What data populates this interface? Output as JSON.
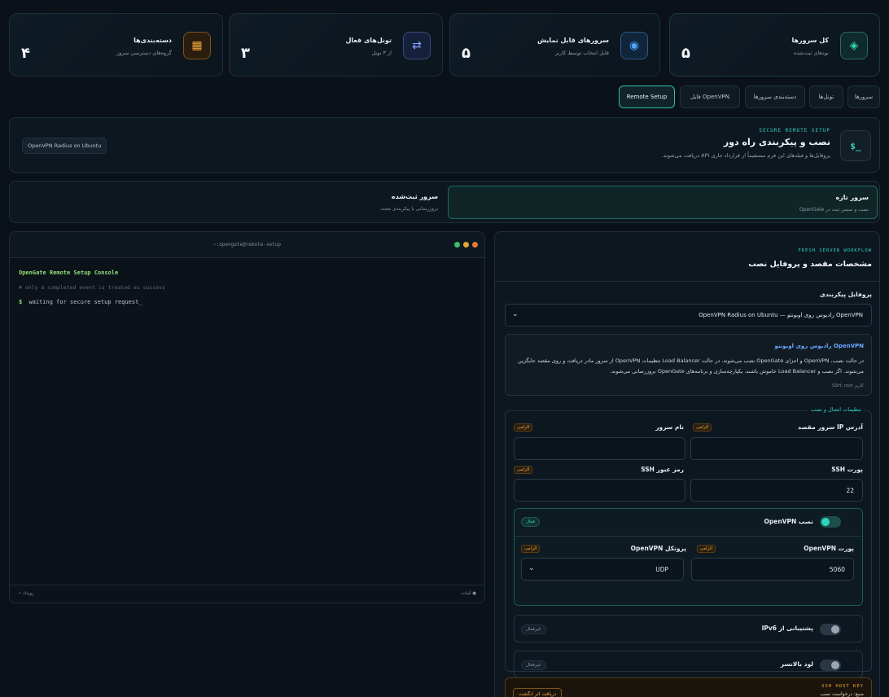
{
  "stats": [
    {
      "label": "کل سرورها",
      "sub": "نودهای ثبت‌شده",
      "value": "۵",
      "icon": "diamond-icon"
    },
    {
      "label": "سرورهای قابل نمایش",
      "sub": "قابل انتخاب توسط کاربر",
      "value": "۵",
      "icon": "target-icon"
    },
    {
      "label": "تونل‌های فعال",
      "sub": "از ۳ تونل",
      "value": "۳",
      "icon": "swap-arrows-icon"
    },
    {
      "label": "دسته‌بندی‌ها",
      "sub": "گروه‌های دسترسی سرور",
      "value": "۴",
      "icon": "grid-icon"
    }
  ],
  "tabs": [
    "سرورها",
    "تونل‌ها",
    "دسته‌بندی سرورها",
    "فایل OpenVPN",
    "Remote Setup"
  ],
  "header": {
    "kicker": "SECURE REMOTE SETUP",
    "title": "نصب و پیکربندی راه دور",
    "desc": "پروفایل‌ها و فیلدهای این فرم مستقیماً از قرارداد جاری API دریافت می‌شوند.",
    "badge": "OpenVPN Radius on Ubuntu",
    "icon_text": "$_"
  },
  "modes": [
    {
      "title": "سرور تازه",
      "sub": "نصب و سپس ثبت در OpenGate"
    },
    {
      "title": "سرور ثبت‌شده",
      "sub": "بروزرسانی یا پیکربندی مجدد"
    }
  ],
  "terminal": {
    "title": "~:opengate@remote-setup",
    "heading": "OpenGate Remote Setup Console",
    "comment": "# only a completed event is treated as success",
    "prompt": "$",
    "line": "waiting for secure setup request_",
    "footer_left": "• رویداد",
    "footer_right": "آماده"
  },
  "form": {
    "kicker": "FRESH SERVER WORKFLOW",
    "title": "مشخصات مقصد و پروفایل نصب",
    "profile_label": "پروفایل پیکربندی",
    "profile_value": "OpenVPN رادیوس روی اوبونتو — OpenVPN Radius on Ubuntu",
    "info_title": "OpenVPN رادیوس روی اوبونتو",
    "info_text": "در حالت نصب، OpenVPN و اجزای OpenGate نصب می‌شوند. در حالت Load Balancer تنظیمات OpenVPN از سرور مادر دریافت و روی مقصد جایگزین می‌شوند. اگر نصب و Load Balancer خاموش باشند، یکپارچه‌سازی و برنامه‌های OpenGate بروزرسانی می‌شوند.",
    "info_user": "کاربر SSH: root",
    "section_title": "تنظیمات اتصال و نصب",
    "required": "الزامی",
    "ip_label": "آدرس IP سرور مقصد",
    "name_label": "نام سرور",
    "ssh_port_label": "پورت SSH",
    "ssh_port_value": "22",
    "ssh_pass_label": "رمز عبور SSH",
    "install_ovpn_label": "نصب OpenVPN",
    "install_ovpn_status": "فعال",
    "ovpn_port_label": "پورت OpenVPN",
    "ovpn_port_value": "5060",
    "ovpn_proto_label": "پروتکل OpenVPN",
    "ovpn_proto_value": "UDP",
    "ipv6_label": "پشتیبانی از IPv6",
    "ipv6_status": "غیرفعال",
    "lb_label": "لود بالانسر",
    "lb_status": "غیرفعال",
    "host_key_kicker": "SSH HOST KEY",
    "host_key_text": "منبع: درخواست نصب",
    "host_key_button": "دریافت اثر انگشت"
  },
  "colors": {
    "accent": "#2dd4bf",
    "bg": "#0a1118",
    "warn": "#f2a93b"
  }
}
